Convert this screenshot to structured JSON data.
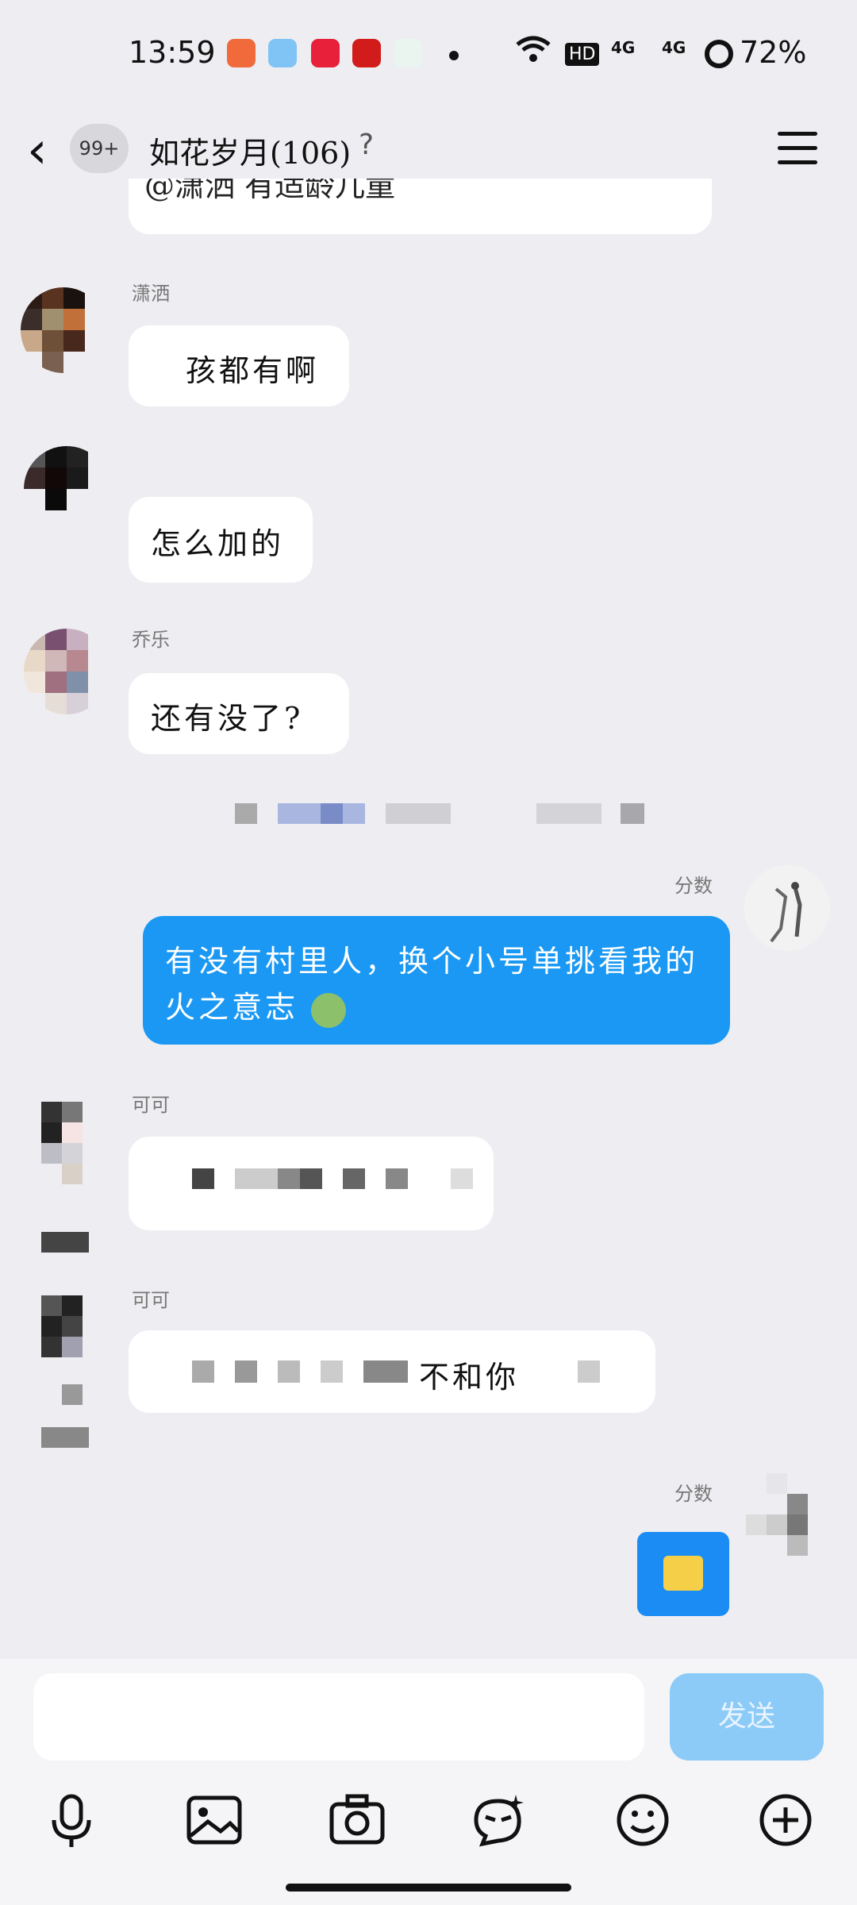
{
  "status_bar": {
    "time": "13:59",
    "hd_label": "HD",
    "net1": "4G",
    "net2": "4G",
    "battery": "72%"
  },
  "header": {
    "unread_badge": "99+",
    "title": "如花岁月(106)"
  },
  "messages": [
    {
      "sender": "潇洒",
      "text": "孩都有啊"
    },
    {
      "sender": "",
      "text": "怎么加的"
    },
    {
      "sender": "乔乐",
      "text": "还有没了?"
    },
    {
      "sender": "分数",
      "text": "有没有村里人，换个小号单挑看我的火之意志"
    },
    {
      "sender": "可可",
      "text": ""
    },
    {
      "sender": "可可",
      "text": "不和你"
    },
    {
      "sender": "分数",
      "text": ""
    }
  ],
  "input": {
    "placeholder": "",
    "send_label": "发送"
  },
  "toolbar": {
    "icons": [
      "microphone-icon",
      "image-icon",
      "camera-icon",
      "magic-emoji-icon",
      "smiley-icon",
      "plus-icon"
    ]
  },
  "colors": {
    "my_bubble": "#1a98f3",
    "send_button": "#8ccbf7",
    "background": "#eeeef2"
  }
}
